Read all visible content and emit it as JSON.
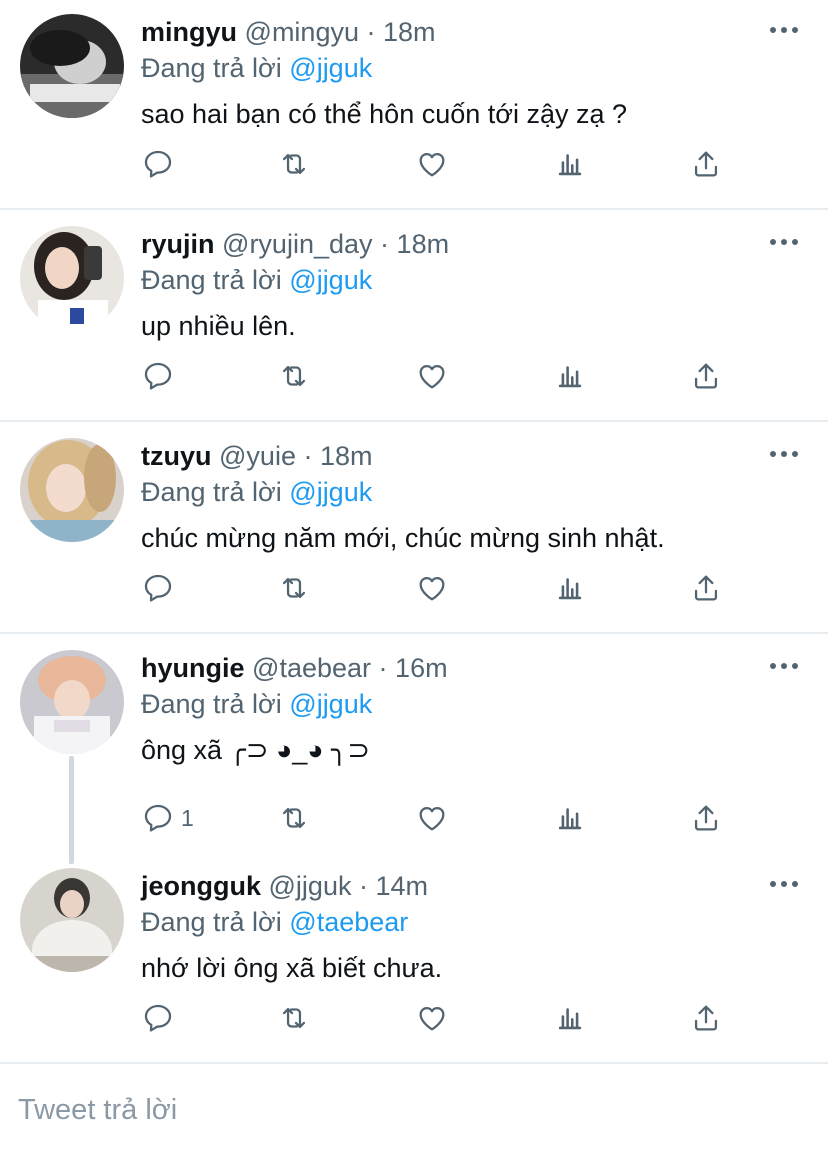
{
  "tweets": [
    {
      "name": "mingyu",
      "handle": "@mingyu",
      "dot": "·",
      "time": "18m",
      "reply_prefix": "Đang trả lời",
      "reply_to": "@jjguk",
      "text": "sao hai bạn có thể hôn cuốn tới zậy zạ ?",
      "reply_count": ""
    },
    {
      "name": "ryujin",
      "handle": "@ryujin_day",
      "dot": "·",
      "time": "18m",
      "reply_prefix": "Đang trả lời",
      "reply_to": "@jjguk",
      "text": "up nhiều lên.",
      "reply_count": ""
    },
    {
      "name": "tzuyu",
      "handle": "@yuie",
      "dot": "·",
      "time": "18m",
      "reply_prefix": "Đang trả lời",
      "reply_to": "@jjguk",
      "text": "chúc mừng năm mới, chúc mừng sinh nhật.",
      "reply_count": ""
    },
    {
      "name": "hyungie",
      "handle": "@taebear",
      "dot": "·",
      "time": "16m",
      "reply_prefix": "Đang trả lời",
      "reply_to": "@jjguk",
      "text": "ông xã ╭⊃ ◕_◕ ╮⊃",
      "reply_count": "1"
    },
    {
      "name": "jeongguk",
      "handle": "@jjguk",
      "dot": "·",
      "time": "14m",
      "reply_prefix": "Đang trả lời",
      "reply_to": "@taebear",
      "text": "nhớ lời ông xã biết chưa.",
      "reply_count": ""
    }
  ],
  "composer": {
    "placeholder": "Tweet trả lời"
  },
  "colors": {
    "text": "#0f1419",
    "muted": "#536471",
    "mention": "#1d9bf0",
    "separator": "#e6ecf0",
    "thread_line": "#cfd9de"
  },
  "icons": [
    "reply-icon",
    "retweet-icon",
    "like-icon",
    "stats-icon",
    "share-icon",
    "more-icon"
  ]
}
